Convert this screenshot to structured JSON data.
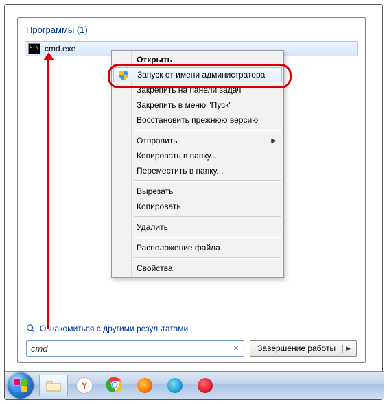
{
  "group": {
    "title": "Программы (1)"
  },
  "result": {
    "name": "cmd.exe"
  },
  "context_menu": {
    "open": "Открыть",
    "run_as_admin": "Запуск от имени администратора",
    "pin_taskbar": "Закрепить на панели задач",
    "pin_start": "Закрепить в меню \"Пуск\"",
    "restore_prev": "Восстановить прежнюю версию",
    "send_to": "Отправить",
    "copy_to": "Копировать в папку...",
    "move_to": "Переместить в папку...",
    "cut": "Вырезать",
    "copy": "Копировать",
    "delete": "Удалить",
    "file_location": "Расположение файла",
    "properties": "Свойства"
  },
  "more_results": "Ознакомиться с другими результатами",
  "search": {
    "value": "cmd"
  },
  "shutdown": {
    "label": "Завершение работы"
  }
}
